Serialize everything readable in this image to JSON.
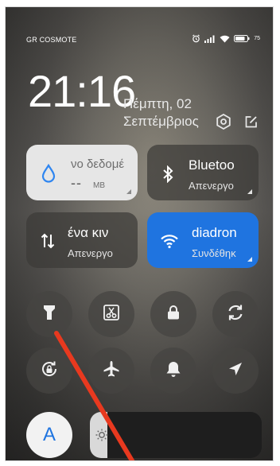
{
  "status_bar": {
    "carrier": "GR COSMOTE",
    "battery_percent": "75"
  },
  "header": {
    "time": "21:16",
    "date_line1": "Πέμπτη, 02",
    "date_line2": "Σεπτέμβριος"
  },
  "tiles": {
    "mobile_data": {
      "label": "νο δεδομέ",
      "value": "--",
      "unit": "MB"
    },
    "bluetooth": {
      "label": "Bluetoo",
      "status": "Απενεργο"
    },
    "mobile_network": {
      "label": "ένα κιν",
      "status": "Απενεργο"
    },
    "wifi": {
      "label": "diadron",
      "status": "Συνδέθηκ"
    }
  },
  "toggles": [
    {
      "icon": "flashlight-icon"
    },
    {
      "icon": "screenshot-icon"
    },
    {
      "icon": "lock-icon"
    },
    {
      "icon": "autorotate-icon"
    },
    {
      "icon": "rotation-lock-icon"
    },
    {
      "icon": "airplane-icon"
    },
    {
      "icon": "bell-icon"
    },
    {
      "icon": "location-icon"
    }
  ],
  "bottom": {
    "font_button_label": "A",
    "brightness_level": 0.1
  },
  "colors": {
    "accent": "#1f74e0",
    "annotation": "#e8391f"
  }
}
